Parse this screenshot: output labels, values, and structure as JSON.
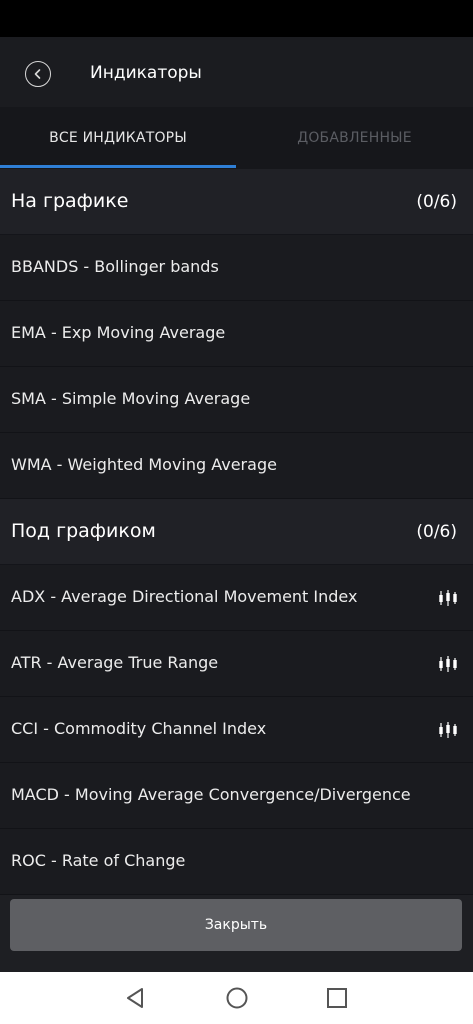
{
  "header": {
    "title": "Индикаторы"
  },
  "tabs": [
    {
      "label": "ВСЕ ИНДИКАТОРЫ",
      "active": true
    },
    {
      "label": "ДОБАВЛЕННЫЕ",
      "active": false
    }
  ],
  "sections": [
    {
      "title": "На графике",
      "count": "(0/6)",
      "items": [
        {
          "label": "BBANDS - Bollinger bands",
          "premium_icon": false
        },
        {
          "label": "EMA - Exp Moving Average",
          "premium_icon": false
        },
        {
          "label": "SMA - Simple Moving Average",
          "premium_icon": false
        },
        {
          "label": "WMA - Weighted Moving Average",
          "premium_icon": false
        }
      ]
    },
    {
      "title": "Под графиком",
      "count": "(0/6)",
      "items": [
        {
          "label": "ADX - Average Directional Movement Index",
          "premium_icon": true
        },
        {
          "label": "ATR - Average True Range",
          "premium_icon": true
        },
        {
          "label": "CCI - Commodity Channel Index",
          "premium_icon": true
        },
        {
          "label": "MACD - Moving Average Convergence/Divergence",
          "premium_icon": false
        },
        {
          "label": "ROC - Rate of Change",
          "premium_icon": false
        }
      ]
    }
  ],
  "close_button": {
    "label": "Закрыть"
  },
  "colors": {
    "accent": "#2f7fd6",
    "background": "#1e1f23"
  },
  "icons": {
    "back": "chevron-left-circle-icon",
    "row_indicator": "candlestick-icon",
    "nav": [
      "back-triangle-icon",
      "home-circle-icon",
      "recents-square-icon"
    ]
  }
}
